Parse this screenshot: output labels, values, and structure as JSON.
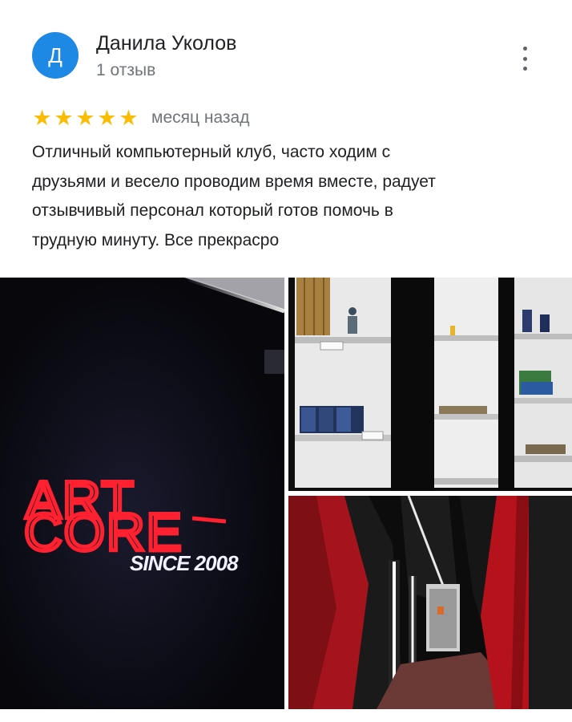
{
  "author": {
    "initial": "Д",
    "name": "Данила Уколов",
    "reviews_count": "1 отзыв"
  },
  "menu_icon": "more-vert-icon",
  "rating": {
    "stars": 5,
    "max": 5,
    "date": "месяц назад",
    "color": "#fbbc04"
  },
  "review": {
    "lines": [
      "Отличный компьютерный клуб, часто ходим с",
      "друзьями и весело проводим время вместе, радует",
      "отзывчивый персонал который готов помочь в",
      "трудную минуту. Все прекрасро"
    ]
  },
  "photos": {
    "sign": {
      "line1": "ART",
      "line2": "CORE",
      "line3": "SINCE 2008"
    }
  },
  "colors": {
    "avatar": "#1e88e5",
    "sign_red": "#ff2030"
  }
}
